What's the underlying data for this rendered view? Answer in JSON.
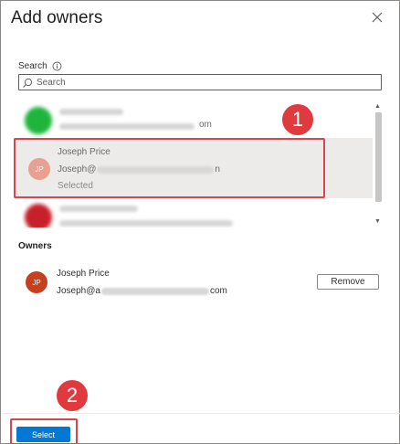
{
  "dialog": {
    "title": "Add owners"
  },
  "search": {
    "label": "Search",
    "placeholder": "Search"
  },
  "results": {
    "selected": {
      "initials": "JP",
      "name": "Joseph Price",
      "email_prefix": "Joseph@",
      "email_suffix": "n",
      "status": "Selected"
    },
    "row1_email_suffix": "om"
  },
  "owners": {
    "heading": "Owners",
    "items": [
      {
        "initials": "JP",
        "name": "Joseph Price",
        "email_prefix": "Joseph@a",
        "email_suffix": "com",
        "remove_label": "Remove"
      }
    ]
  },
  "footer": {
    "select_label": "Select"
  },
  "callouts": {
    "one": "1",
    "two": "2"
  },
  "colors": {
    "primary": "#0078d4",
    "highlight": "#d9454d",
    "owner_avatar": "#c4401f",
    "selected_avatar": "#e8a090"
  }
}
